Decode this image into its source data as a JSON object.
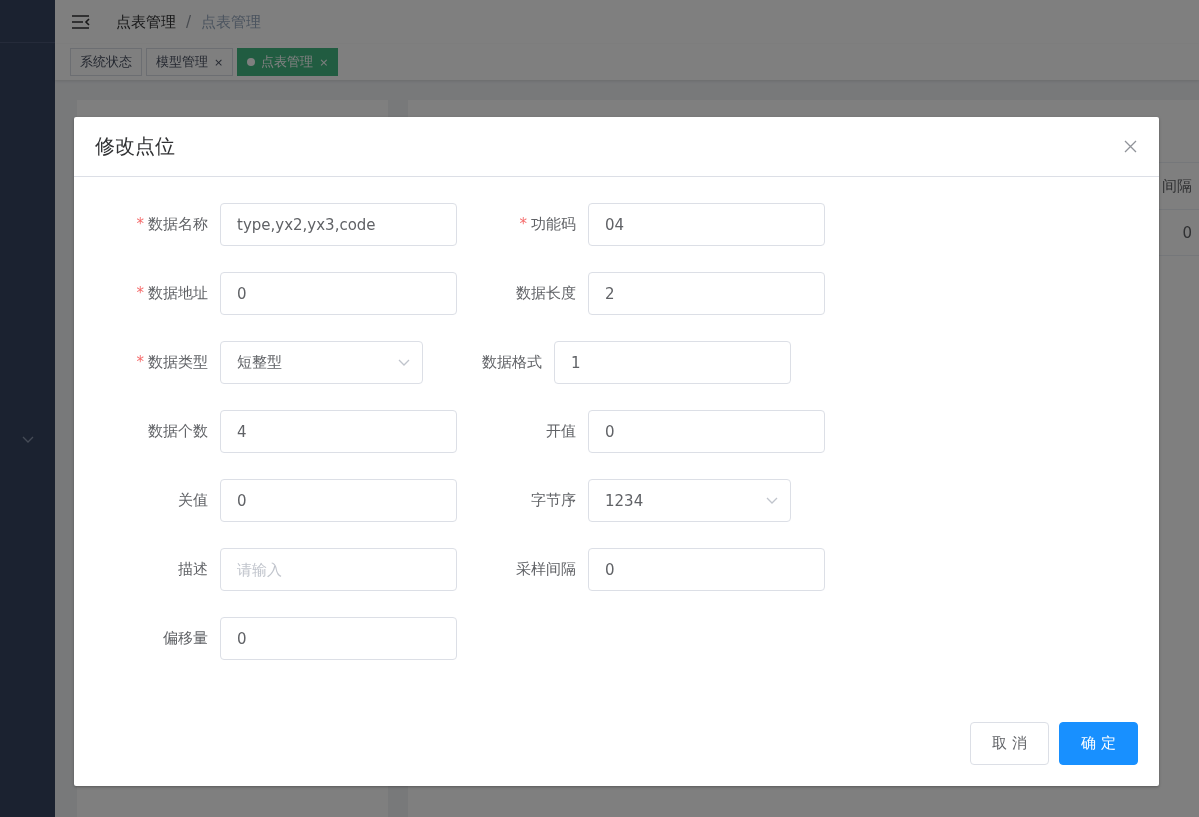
{
  "breadcrumb": [
    {
      "label": "点表管理",
      "current": false
    },
    {
      "label": "点表管理",
      "current": true
    }
  ],
  "breadcrumb_separator": "/",
  "tags": [
    {
      "label": "系统状态",
      "closable": false,
      "selected": false
    },
    {
      "label": "模型管理",
      "closable": true,
      "selected": false,
      "close": "×"
    },
    {
      "label": "点表管理",
      "closable": true,
      "selected": true,
      "close": "×"
    }
  ],
  "table": {
    "header": "间隔",
    "cell": "0"
  },
  "dialog": {
    "title": "修改点位",
    "fields": [
      {
        "label": "数据名称",
        "required": true,
        "kind": "input",
        "value": "type,yx2,yx3,code"
      },
      {
        "label": "功能码",
        "required": true,
        "kind": "input",
        "value": "04"
      },
      {
        "label": "数据地址",
        "required": true,
        "kind": "input",
        "value": "0"
      },
      {
        "label": "数据长度",
        "required": false,
        "kind": "input",
        "value": "2"
      },
      {
        "label": "数据类型",
        "required": true,
        "kind": "select",
        "value": "短整型"
      },
      {
        "label": "数据格式",
        "required": false,
        "kind": "input",
        "value": "1"
      },
      {
        "label": "数据个数",
        "required": false,
        "kind": "input",
        "value": "4"
      },
      {
        "label": "开值",
        "required": false,
        "kind": "input",
        "value": "0"
      },
      {
        "label": "关值",
        "required": false,
        "kind": "input",
        "value": "0"
      },
      {
        "label": "字节序",
        "required": false,
        "kind": "select",
        "value": "1234"
      },
      {
        "label": "描述",
        "required": false,
        "kind": "input",
        "placeholder": "请输入"
      },
      {
        "label": "采样间隔",
        "required": false,
        "kind": "input",
        "value": "0"
      },
      {
        "label": "偏移量",
        "required": false,
        "kind": "input",
        "value": "0"
      }
    ],
    "required_mark": "*",
    "buttons": [
      {
        "label": "取 消",
        "kind": "default"
      },
      {
        "label": "确 定",
        "kind": "primary"
      }
    ]
  }
}
